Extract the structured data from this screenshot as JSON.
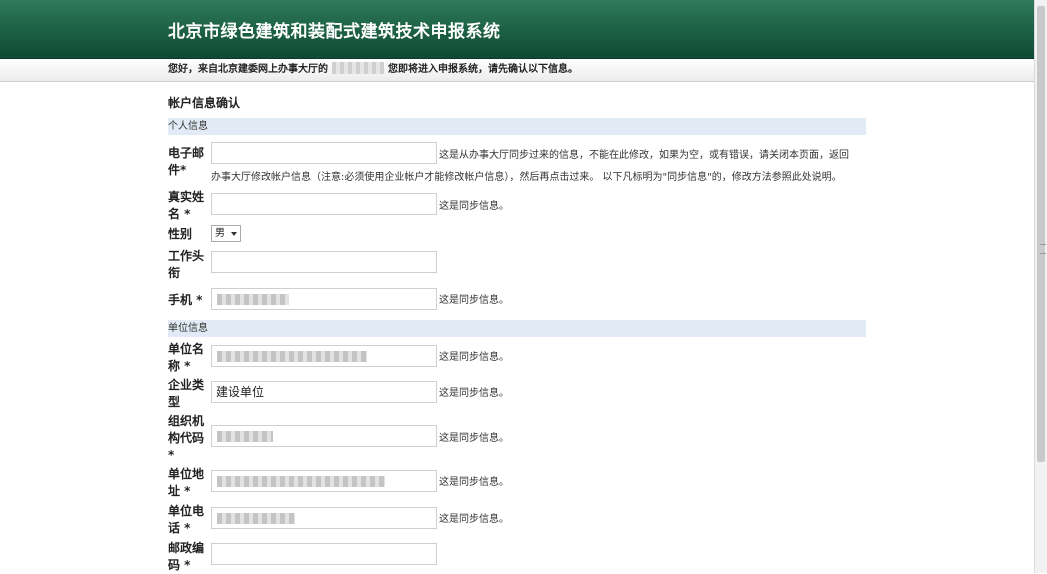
{
  "header": {
    "title": "北京市绿色建筑和装配式建筑技术申报系统"
  },
  "welcome": {
    "prefix": "您好，来自北京建委网上办事大厅的",
    "suffix": "您即将进入申报系统，请先确认以下信息。"
  },
  "page": {
    "section_title": "帐户信息确认"
  },
  "personal": {
    "header": "个人信息",
    "email": {
      "label": "电子邮件*",
      "value": "",
      "note_line1": "这是从办事大厅同步过来的信息，不能在此修改，如果为空，或有错误，请关闭本页面，返回",
      "note_line2": "办事大厅修改帐户信息（注意:必须使用企业帐户才能修改帐户信息），然后再点击过来。 以下凡标明为\"同步信息\"的，修改方法参照此处说明。"
    },
    "realname": {
      "label": "真实姓名 *",
      "value": "",
      "note": "这是同步信息。"
    },
    "gender": {
      "label": "性别",
      "value": "男"
    },
    "title": {
      "label": "工作头衔",
      "value": ""
    },
    "phone": {
      "label": "手机 *",
      "note": "这是同步信息。"
    }
  },
  "company": {
    "header": "单位信息",
    "name": {
      "label": "单位名称 *",
      "note": "这是同步信息。"
    },
    "type": {
      "label": "企业类型",
      "value": "建设单位",
      "note": "这是同步信息。"
    },
    "orgcode": {
      "label": "组织机构代码 *",
      "note": "这是同步信息。"
    },
    "address": {
      "label": "单位地址 *",
      "note": "这是同步信息。"
    },
    "tel": {
      "label": "单位电话 *",
      "note": "这是同步信息。"
    },
    "postcode": {
      "label": "邮政编码 *",
      "value": ""
    }
  }
}
